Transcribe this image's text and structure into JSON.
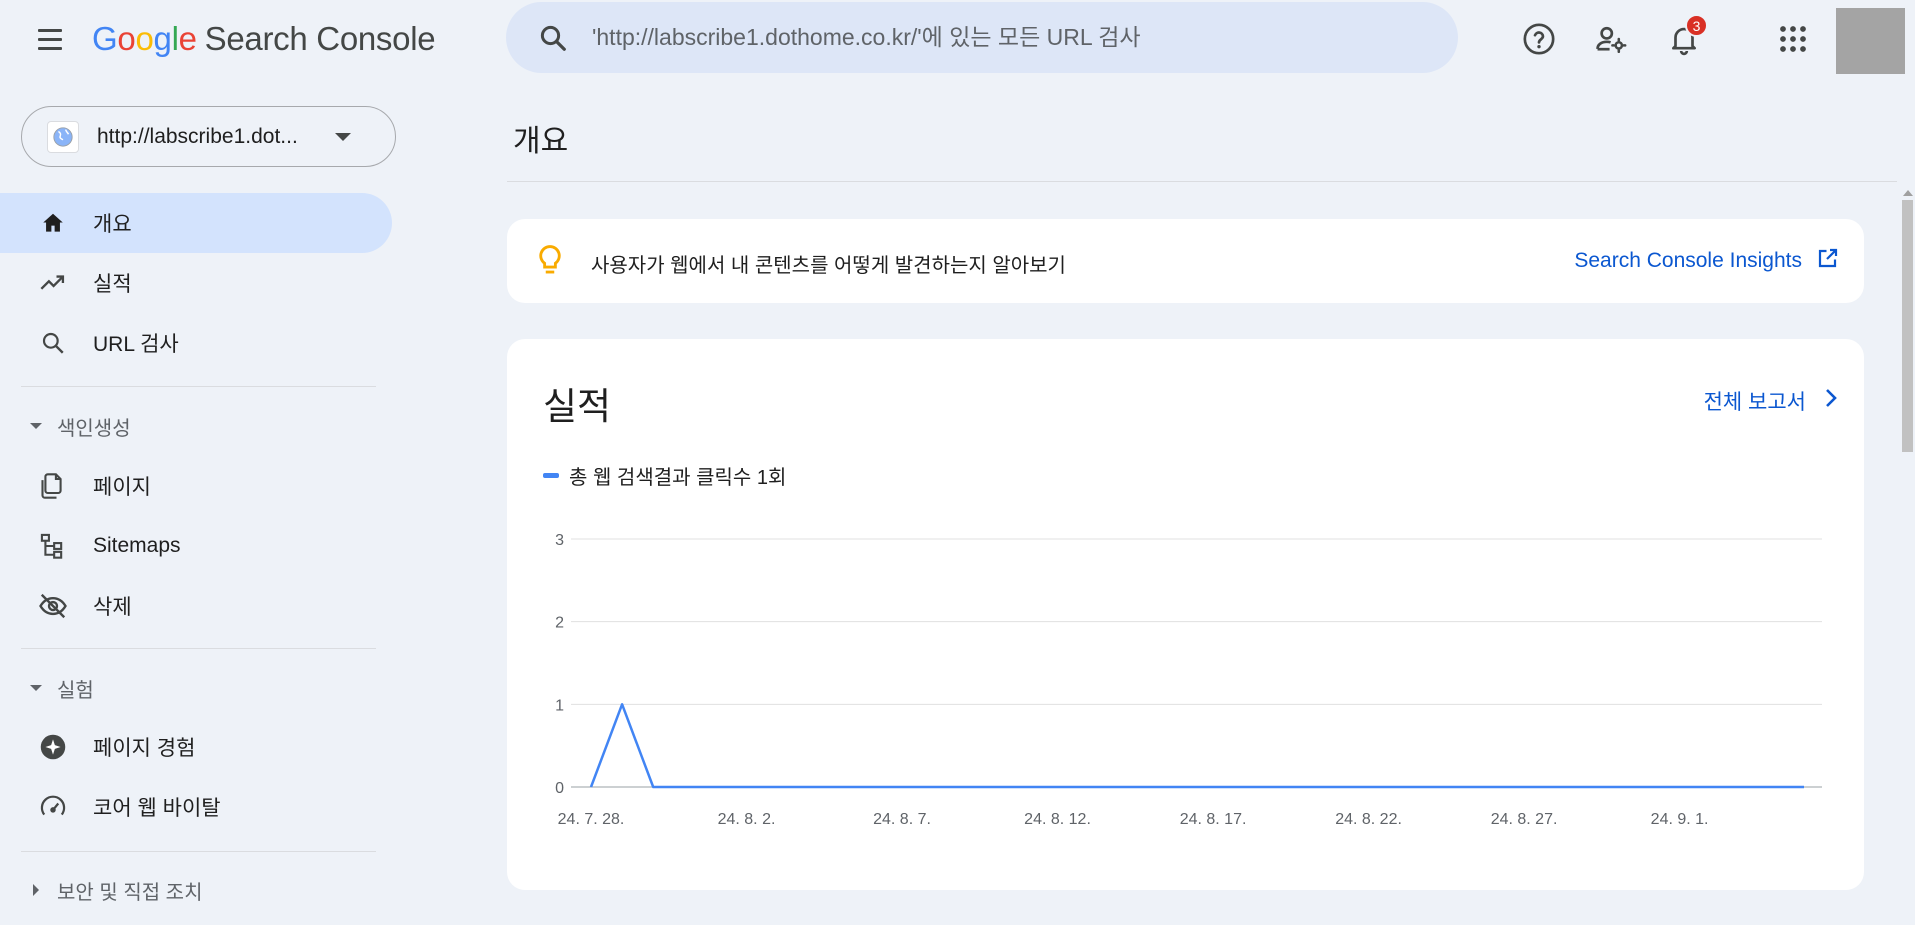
{
  "header": {
    "logo_google": [
      "G",
      "o",
      "o",
      "g",
      "l",
      "e"
    ],
    "logo_colors": [
      "#4285f4",
      "#ea4335",
      "#fbbc05",
      "#4285f4",
      "#34a853",
      "#ea4335"
    ],
    "product_name": "Search Console",
    "search_placeholder": "'http://labscribe1.dothome.co.kr/'에 있는 모든 URL 검사",
    "notification_count": "3"
  },
  "sidebar": {
    "property_label": "http://labscribe1.dot...",
    "items": [
      {
        "label": "개요",
        "icon": "home-icon",
        "active": true
      },
      {
        "label": "실적",
        "icon": "trending-up-icon"
      },
      {
        "label": "URL 검사",
        "icon": "search-icon"
      }
    ],
    "section_indexing": "색인생성",
    "indexing_items": [
      {
        "label": "페이지",
        "icon": "pages-icon"
      },
      {
        "label": "Sitemaps",
        "icon": "sitemap-icon"
      },
      {
        "label": "삭제",
        "icon": "visibility-off-icon"
      }
    ],
    "section_experiments": "실험",
    "experiment_items": [
      {
        "label": "페이지 경험",
        "icon": "page-experience-icon"
      },
      {
        "label": "코어 웹 바이탈",
        "icon": "speed-gauge-icon"
      }
    ],
    "section_security": "보안 및 직접 조치"
  },
  "main": {
    "page_title": "개요",
    "insights_text": "사용자가 웹에서 내 콘텐츠를 어떻게 발견하는지 알아보기",
    "insights_link": "Search Console Insights",
    "performance_title": "실적",
    "full_report_link": "전체 보고서",
    "legend_label": "총 웹 검색결과 클릭수 1회"
  },
  "colors": {
    "accent": "#0b57d0",
    "series": "#4285f4",
    "active_nav": "#d3e3fd",
    "badge": "#d93025"
  },
  "chart_data": {
    "type": "line",
    "series": [
      {
        "name": "총 웹 검색결과 클릭수 1회",
        "values": [
          0,
          1,
          0,
          0,
          0,
          0,
          0,
          0,
          0,
          0,
          0,
          0,
          0,
          0,
          0,
          0,
          0,
          0,
          0,
          0,
          0,
          0,
          0,
          0,
          0,
          0,
          0,
          0,
          0,
          0,
          0,
          0,
          0,
          0,
          0,
          0,
          0,
          0,
          0,
          0
        ]
      }
    ],
    "x_tick_labels": [
      "24. 7. 28.",
      "24. 8. 2.",
      "24. 8. 7.",
      "24. 8. 12.",
      "24. 8. 17.",
      "24. 8. 22.",
      "24. 8. 27.",
      "24. 9. 1."
    ],
    "ylim": [
      0,
      3
    ],
    "y_ticks": [
      0,
      1,
      2,
      3
    ],
    "grid": true
  }
}
